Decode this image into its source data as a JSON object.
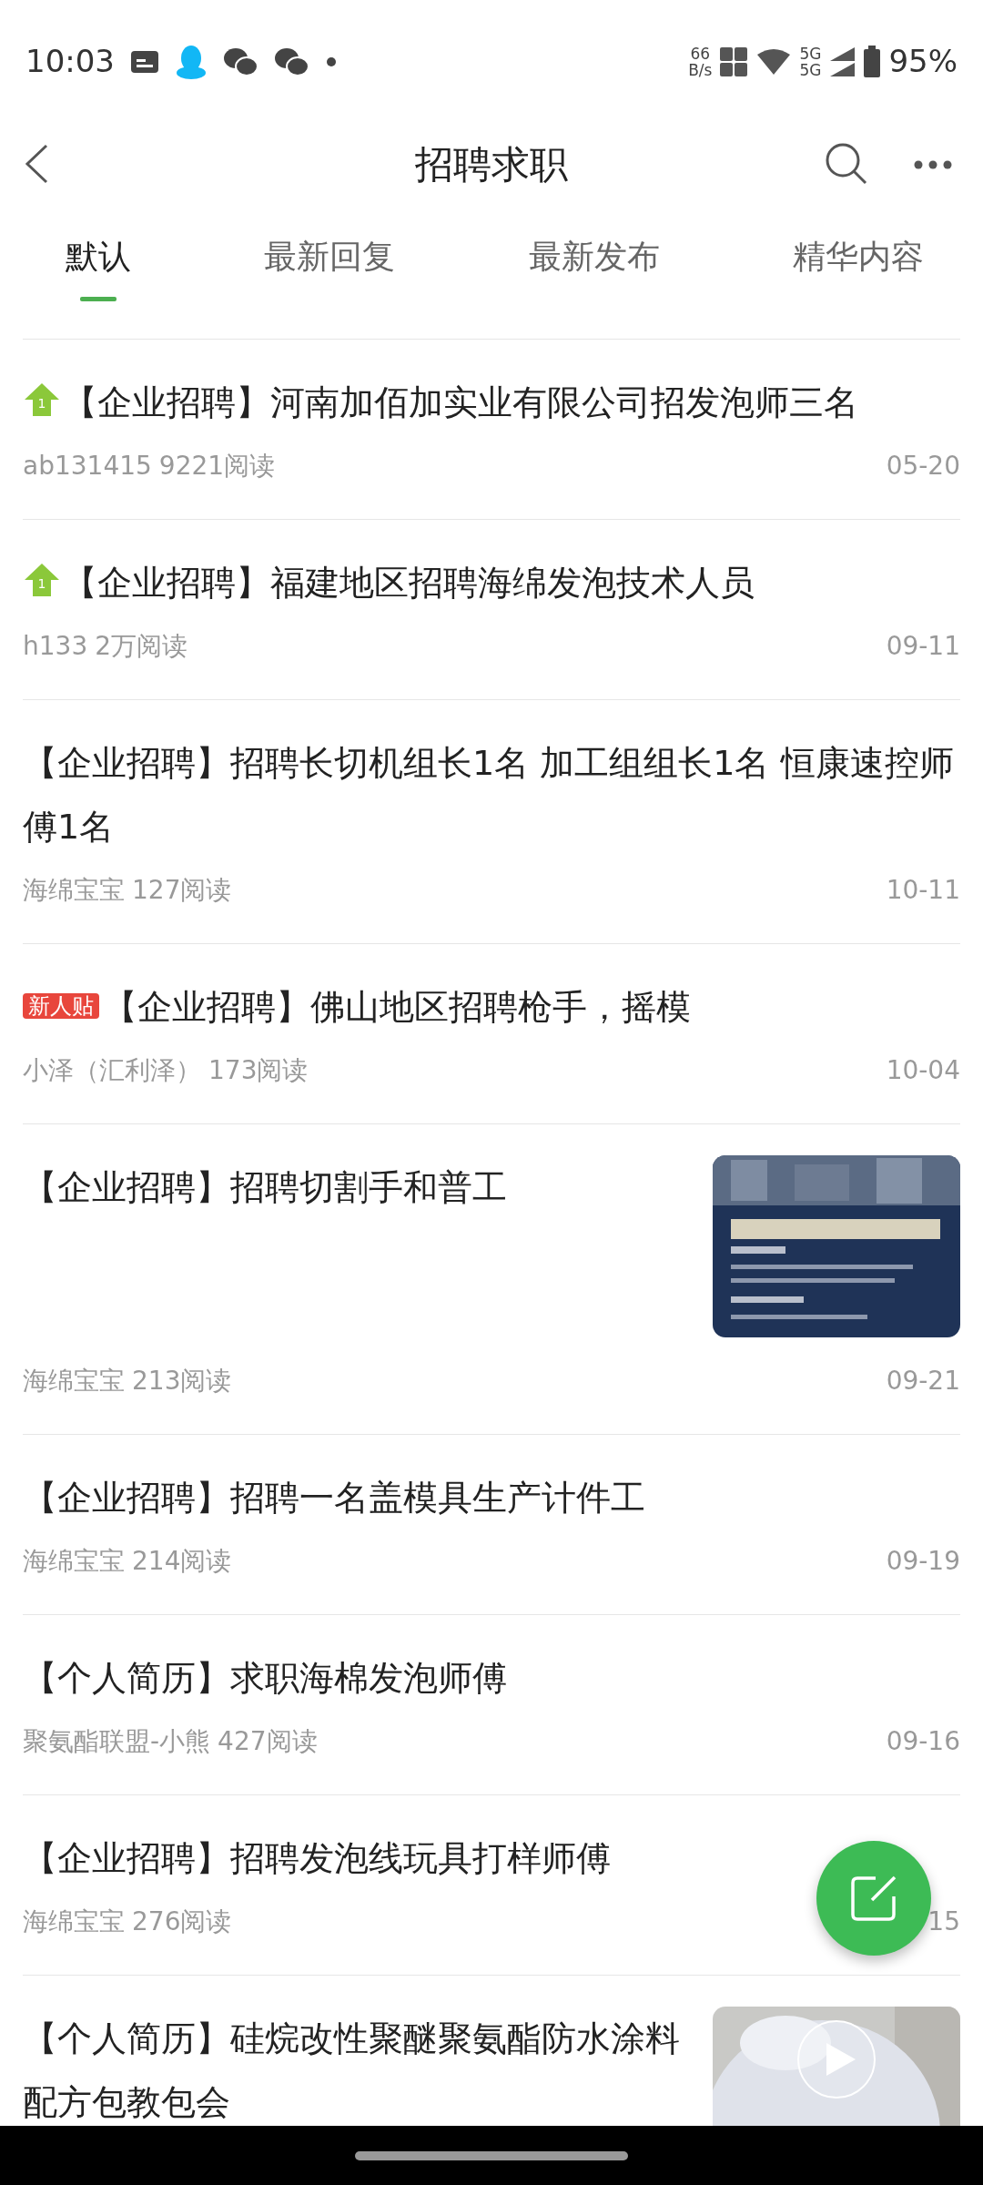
{
  "status_bar": {
    "time": "10:03",
    "net_speed": "66",
    "net_unit": "B/s",
    "signal_1": "5G",
    "signal_2": "5G",
    "battery": "95%"
  },
  "header": {
    "title": "招聘求职"
  },
  "tabs": [
    {
      "label": "默认",
      "selected": true
    },
    {
      "label": "最新回复",
      "selected": false
    },
    {
      "label": "最新发布",
      "selected": false
    },
    {
      "label": "精华内容",
      "selected": false
    }
  ],
  "posts": [
    {
      "tag": {
        "kind": "top",
        "text": "1"
      },
      "title": "【企业招聘】河南加佰加实业有限公司招发泡师三名",
      "author": "ab131415",
      "reads": "9221阅读",
      "date": "05-20"
    },
    {
      "tag": {
        "kind": "top",
        "text": "1"
      },
      "title": "【企业招聘】福建地区招聘海绵发泡技术人员",
      "author": "h133",
      "reads": "2万阅读",
      "date": "09-11"
    },
    {
      "title": "【企业招聘】招聘长切机组长1名 加工组组长1名 恒康速控师傅1名",
      "author": "海绵宝宝",
      "reads": "127阅读",
      "date": "10-11"
    },
    {
      "tag": {
        "kind": "new",
        "text": "新人贴"
      },
      "title": "【企业招聘】佛山地区招聘枪手，摇模",
      "author": "小泽（汇利泽）",
      "reads": "173阅读",
      "date": "10-04"
    },
    {
      "title": "【企业招聘】招聘切割手和普工",
      "author": "海绵宝宝",
      "reads": "213阅读",
      "date": "09-21",
      "thumbnail": {
        "kind": "picture",
        "video": false
      }
    },
    {
      "title": "【企业招聘】招聘一名盖模具生产计件工",
      "author": "海绵宝宝",
      "reads": "214阅读",
      "date": "09-19"
    },
    {
      "title": "【个人简历】求职海棉发泡师傅",
      "author": "聚氨酯联盟-小熊",
      "reads": "427阅读",
      "date": "09-16"
    },
    {
      "title": "【企业招聘】招聘发泡线玩具打样师傅",
      "author": "海绵宝宝",
      "reads": "276阅读",
      "date": "15"
    },
    {
      "title": "【个人简历】硅烷改性聚醚聚氨酯防水涂料配方包教包会",
      "thumbnail": {
        "kind": "picture",
        "video": true
      }
    }
  ]
}
